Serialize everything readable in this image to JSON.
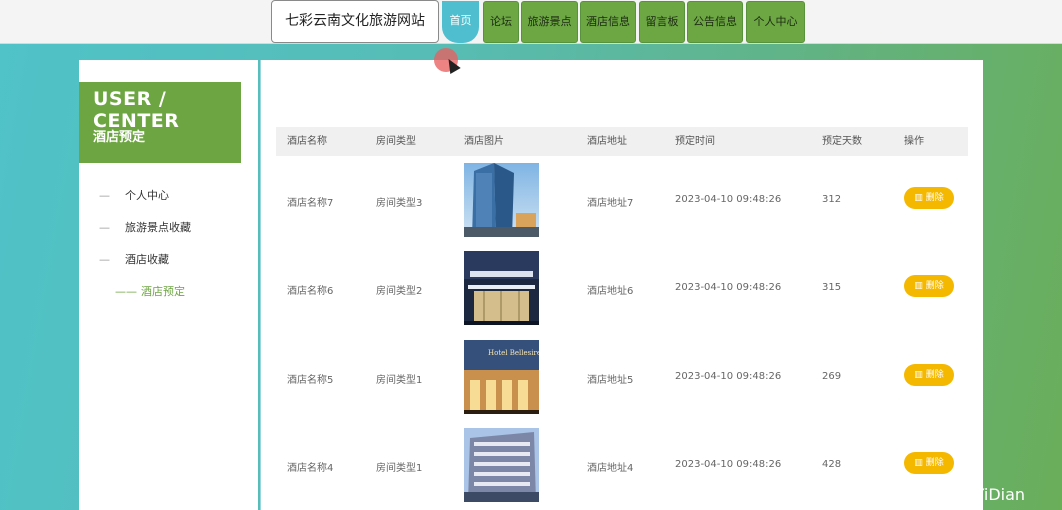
{
  "header": {
    "site_title": "七彩云南文化旅游网站",
    "nav": [
      "首页",
      "论坛",
      "旅游景点",
      "酒店信息",
      "留言板",
      "公告信息",
      "个人中心"
    ]
  },
  "sidebar": {
    "title": "USER / CENTER",
    "subtitle": "酒店预定",
    "items": [
      "个人中心",
      "旅游景点收藏",
      "酒店收藏",
      "酒店预定"
    ],
    "dash": "—",
    "active_dash": "——"
  },
  "table": {
    "columns": [
      "酒店名称",
      "房间类型",
      "酒店图片",
      "酒店地址",
      "预定时间",
      "预定天数",
      "操作"
    ],
    "rows": [
      {
        "name": "酒店名称7",
        "room": "房间类型3",
        "address": "酒店地址7",
        "time": "2023-04-10 09:48:26",
        "days": "312",
        "photo_icon": "hotel-tower-photo"
      },
      {
        "name": "酒店名称6",
        "room": "房间类型2",
        "address": "酒店地址6",
        "time": "2023-04-10 09:48:26",
        "days": "315",
        "photo_icon": "hotel-entrance-photo"
      },
      {
        "name": "酒店名称5",
        "room": "房间类型1",
        "address": "酒店地址5",
        "time": "2023-04-10 09:48:26",
        "days": "269",
        "photo_icon": "hotel-bellesire-photo"
      },
      {
        "name": "酒店名称4",
        "room": "房间类型1",
        "address": "酒店地址4",
        "time": "2023-04-10 09:48:26",
        "days": "428",
        "photo_icon": "hotel-building-photo"
      }
    ],
    "delete_label": "删除",
    "delete_icon": "trash-icon"
  },
  "photo_signs": {
    "bellesire": "Hotel Bellesire"
  },
  "watermark": "CSDN @计算机YiDian",
  "colors": {
    "accent_green": "#6ea543",
    "active_nav": "#4fbfcf",
    "delete_button": "#f5b800"
  }
}
